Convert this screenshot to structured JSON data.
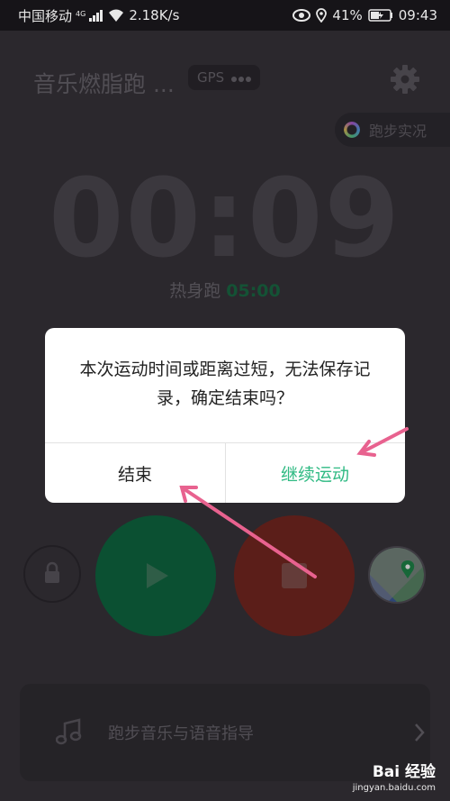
{
  "status_bar": {
    "carrier": "中国移动",
    "net_type": "4G",
    "speed": "2.18K/s",
    "battery": "41%",
    "time": "09:43"
  },
  "header": {
    "title": "音乐燃脂跑 ...",
    "gps_label": "GPS",
    "live_label": "跑步实况"
  },
  "timer": {
    "value": "00:09",
    "warmup_label": "热身跑",
    "warmup_time": "05:00"
  },
  "dialog": {
    "message": "本次运动时间或距离过短，无法保存记录，确定结束吗？",
    "end_button": "结束",
    "continue_button": "继续运动"
  },
  "controls": {
    "lock_icon": "lock-icon",
    "play_icon": "play-icon",
    "stop_icon": "stop-icon",
    "map_icon": "map-icon"
  },
  "music_bar": {
    "label": "跑步音乐与语音指导"
  },
  "watermark": {
    "brand": "Bai 经验",
    "url": "jingyan.baidu.com"
  },
  "colors": {
    "accent_green": "#2fba83",
    "play_green": "#0f6b43",
    "stop_red": "#7a2822",
    "annotation_pink": "#e8628f"
  }
}
